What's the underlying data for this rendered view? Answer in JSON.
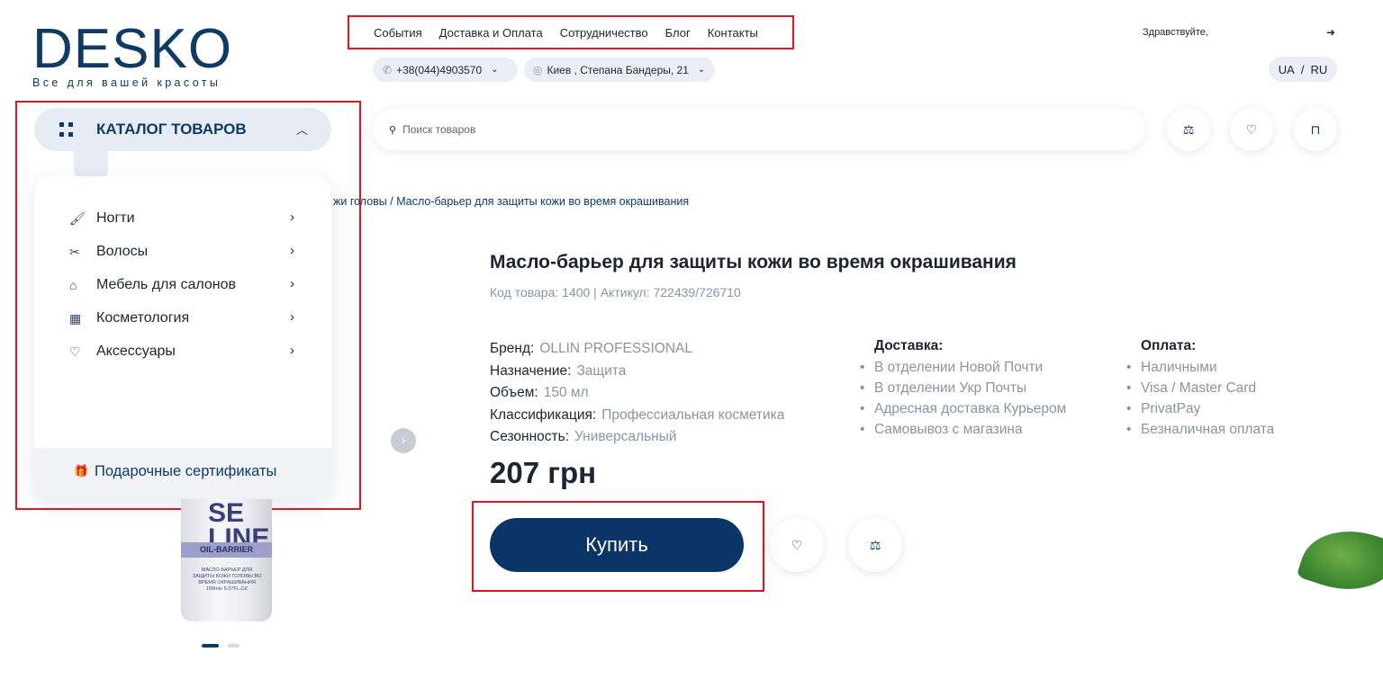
{
  "logo": {
    "word": "DESKO",
    "tagline": "Все для вашей красоты"
  },
  "top_nav": [
    "События",
    "Доставка и Оплата",
    "Сотрудничество",
    "Блог",
    "Контакты"
  ],
  "contacts": {
    "phone": "+38(044)4903570",
    "address": "Киев , Степана Бандеры, 21"
  },
  "account": {
    "greeting": "Здравствуйте,"
  },
  "lang": {
    "ua": "UA",
    "sep": "/",
    "ru": "RU"
  },
  "catalog": {
    "label": "КАТАЛОГ ТОВАРОВ",
    "items": [
      {
        "label": "Ногти",
        "icon": "nail-polish-icon"
      },
      {
        "label": "Волосы",
        "icon": "hair-icon"
      },
      {
        "label": "Мебель для салонов",
        "icon": "salon-chair-icon"
      },
      {
        "label": "Косметология",
        "icon": "cosmetology-icon"
      },
      {
        "label": "Аксессуары",
        "icon": "accessories-icon"
      }
    ],
    "gift_label": "Подарочные сертификаты"
  },
  "search": {
    "placeholder": "Поиск товаров"
  },
  "breadcrumb": "жи головы / Масло-барьер для защиты кожи во время окрашивания",
  "product_image": {
    "brand_text": "SE LINE",
    "band": "OIL-BARRIER",
    "label_text": "МАСЛО-БАРЬЕР ДЛЯ ЗАЩИТЫ КОЖИ ГОЛОВЫ ВО ВРЕМЯ ОКРАШИВАНИЯ 150ml℮ 5.07FL.OZ"
  },
  "product": {
    "title": "Масло-барьер для защиты кожи во время окрашивания",
    "code": "Код товара: 1400 | Актикул: 722439/726710",
    "specs": [
      {
        "key": "Бренд:",
        "value": "OLLIN PROFESSIONAL"
      },
      {
        "key": "Назначение:",
        "value": "Защита"
      },
      {
        "key": "Объем:",
        "value": "150 мл"
      },
      {
        "key": "Классификация:",
        "value": "Профессиальная косметика"
      },
      {
        "key": "Сезонность:",
        "value": "Универсальный"
      }
    ],
    "price": "207 грн",
    "buy_label": "Купить"
  },
  "delivery": {
    "title": "Доставка:",
    "items": [
      "В отделении Новой Почти",
      "В отделении Укр Почты",
      "Адресная доставка Курьером",
      "Самовывоз с магазина"
    ]
  },
  "payment": {
    "title": "Оплата:",
    "items": [
      "Наличными",
      "Visa / Master Card",
      "PrivatPay",
      "Безналичная оплата"
    ]
  },
  "colors": {
    "brand": "#0f3a66",
    "button": "#0b3566",
    "highlight": "#e8141c",
    "muted": "#8b93a3"
  }
}
